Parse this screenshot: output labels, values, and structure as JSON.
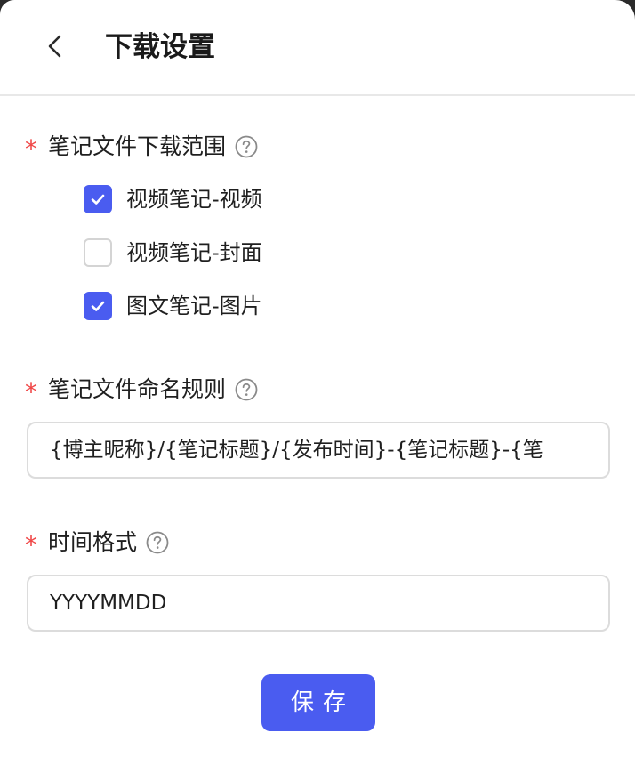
{
  "header": {
    "title": "下载设置",
    "back_icon": "chevron-left-icon"
  },
  "form": {
    "required_mark": "*",
    "download_scope": {
      "label": "笔记文件下载范围",
      "options": [
        {
          "label": "视频笔记-视频",
          "checked": true
        },
        {
          "label": "视频笔记-封面",
          "checked": false
        },
        {
          "label": "图文笔记-图片",
          "checked": true
        }
      ]
    },
    "naming_rule": {
      "label": "笔记文件命名规则",
      "value": "{博主昵称}/{笔记标题}/{发布时间}-{笔记标题}-{笔"
    },
    "time_format": {
      "label": "时间格式",
      "value": "YYYYMMDD"
    }
  },
  "actions": {
    "save_label": "保存"
  },
  "colors": {
    "accent": "#4a5cf0",
    "required": "#f04848",
    "border": "#dcdcdc"
  }
}
